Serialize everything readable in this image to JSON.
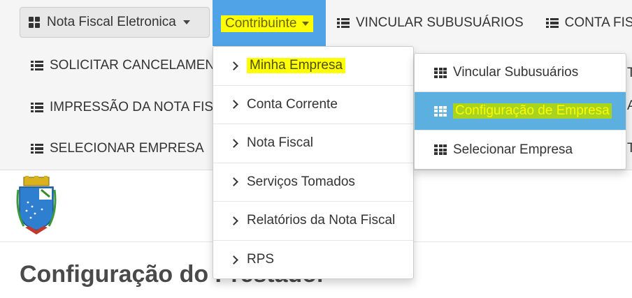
{
  "navbar": {
    "nota_fiscal_label": "Nota Fiscal Eletronica",
    "contribuinte_label": "Contribuinte",
    "items_row1": [
      {
        "label": "VINCULAR SUBUSUÁRIOS"
      },
      {
        "label": "CONTA FISC"
      }
    ],
    "items_left": [
      {
        "label": "SOLICITAR CANCELAMENT"
      },
      {
        "label": "IMPRESSÃO DA NOTA FISC"
      },
      {
        "label": "SELECIONAR EMPRESA"
      }
    ],
    "edge_glyphs": [
      "T",
      "A",
      "T"
    ]
  },
  "contribuinte_menu": {
    "items": [
      {
        "label": "Minha Empresa"
      },
      {
        "label": "Conta Corrente"
      },
      {
        "label": "Nota Fiscal"
      },
      {
        "label": "Serviços Tomados"
      },
      {
        "label": "Relatórios da Nota Fiscal"
      },
      {
        "label": "RPS"
      }
    ]
  },
  "submenu": {
    "items": [
      {
        "label": "Vincular Subusuários"
      },
      {
        "label": "Configuração de Empresa"
      },
      {
        "label": "Selecionar Empresa"
      }
    ]
  },
  "page": {
    "title": "Configuração do Prestador"
  },
  "colors": {
    "active_blue": "#4fa3e6",
    "highlight_yellow": "#ffff00",
    "highlight_green": "#a8d31f",
    "submenu_active": "#5bb0e0",
    "navbar_bg": "#f5f5f5"
  }
}
